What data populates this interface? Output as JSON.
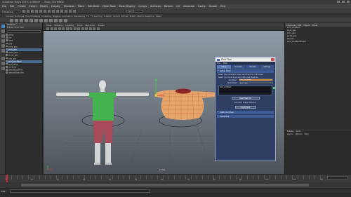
{
  "window": {
    "title": "Autodesk Maya 2019: untitled*  ---  Body_ShirtMesh"
  },
  "menubar": {
    "items": [
      "File",
      "Edit",
      "Create",
      "Select",
      "Modify",
      "Display",
      "Windows",
      "Mesh",
      "Edit Mesh",
      "Mesh Tools",
      "Mesh Display",
      "Curves",
      "Surfaces",
      "Deform",
      "UV",
      "Generate",
      "Cache",
      "Arnold",
      "Help"
    ]
  },
  "status_line": {
    "mode": "Modeling",
    "search_placeholder": "Search"
  },
  "shelf": {
    "tabs": [
      "Curves / Surfaces",
      "Poly Modeling",
      "Sculpting",
      "Rigging",
      "Animation",
      "Rendering",
      "FX",
      "FX Caching",
      "Custom",
      "Arnold",
      "Bifrost",
      "MASH",
      "Motion Graphics",
      "XGen"
    ]
  },
  "outliner": {
    "title": "Outliner",
    "menu": "Display  Show  Help",
    "items": [
      {
        "label": "persp",
        "selected": false
      },
      {
        "label": "top",
        "selected": false
      },
      {
        "label": "front",
        "selected": false
      },
      {
        "label": "side",
        "selected": false
      },
      {
        "label": "body_geo",
        "selected": false
      },
      {
        "label": "shirt_geo",
        "selected": true
      },
      {
        "label": "pants_geo",
        "selected": false
      },
      {
        "label": "shoes_geo",
        "selected": false
      },
      {
        "label": "hair_geo",
        "selected": false
      },
      {
        "label": "shirt_simMesh",
        "selected": true
      },
      {
        "label": "shirt_wrap",
        "selected": false
      },
      {
        "label": "nucleus1",
        "selected": false
      },
      {
        "label": "defaultLightSet",
        "selected": false
      },
      {
        "label": "defaultObjectSet",
        "selected": false
      }
    ]
  },
  "viewport": {
    "menu": [
      "View",
      "Shading",
      "Lighting",
      "Show",
      "Renderer",
      "Panels"
    ],
    "camera_label": "persp"
  },
  "dialog": {
    "title": "Shirt Tool",
    "menu": [
      "File",
      "Help"
    ],
    "tabs": [
      "Setup",
      "Simulate",
      "Transfer",
      "Settings"
    ],
    "section_open": "Setup Shirt",
    "instructions": [
      "Select the simulation mesh, and then the cloth mesh.",
      "Select your source geo and click Load Mesh Ids."
    ],
    "fields": [
      {
        "label": "Sim Mesh:",
        "value": "shirt_simMesh"
      },
      {
        "label": "Cloth Mesh:",
        "value": "shirt_geo"
      }
    ],
    "list_first": "shirt_simMesh",
    "button_load": "Load Mesh Ids",
    "note": "Add Shirt Shape Influence",
    "button_create": "Create Shirt",
    "sections_closed": [
      "Cloth Controls",
      "Collisions"
    ]
  },
  "attribute_editor": {
    "tabs": [
      "Channels",
      "Edit",
      "Object",
      "Show"
    ],
    "lines": [
      "shirt_simMesh",
      "body_geo",
      "shirt_geo",
      "pants_geo",
      "Shapes",
      "shirt_simMeshShape"
    ],
    "layer_tabs": [
      "Display",
      "Anim"
    ],
    "layer_menu": [
      "Layers",
      "Options",
      "Help"
    ]
  },
  "timeslider": {
    "ticks": [
      "1",
      "10",
      "20",
      "30",
      "40",
      "50",
      "60",
      "70",
      "80",
      "90",
      "100",
      "110",
      "120"
    ],
    "current_frame": "1"
  },
  "command_line": {
    "language": "MEL"
  }
}
